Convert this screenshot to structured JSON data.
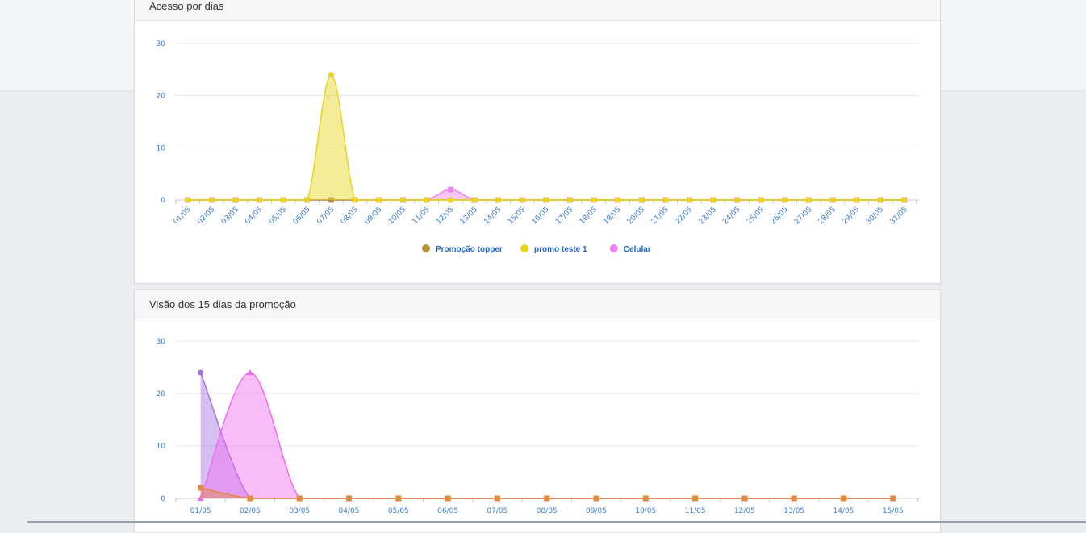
{
  "panels": [
    {
      "title": "Acesso por dias"
    },
    {
      "title": "Visão dos 15 dias da promoção"
    }
  ],
  "chart_data": [
    {
      "type": "area",
      "title": "Acesso por dias",
      "xlabel": "",
      "ylabel": "",
      "ylim": [
        0,
        30
      ],
      "yticks": [
        0,
        10,
        20,
        30
      ],
      "grid": true,
      "legend": "bottom-center",
      "categories": [
        "01/05",
        "02/05",
        "03/05",
        "04/05",
        "05/05",
        "06/05",
        "07/05",
        "08/05",
        "09/05",
        "10/05",
        "11/05",
        "12/05",
        "13/05",
        "14/05",
        "15/05",
        "16/05",
        "17/05",
        "18/05",
        "19/05",
        "20/05",
        "21/05",
        "22/05",
        "23/05",
        "24/05",
        "25/05",
        "26/05",
        "27/05",
        "28/05",
        "29/05",
        "30/05",
        "31/05"
      ],
      "series": [
        {
          "name": "Promoção topper",
          "color": "#b0923a",
          "marker": "circle",
          "values": [
            0,
            0,
            0,
            0,
            0,
            0,
            0,
            0,
            0,
            0,
            0,
            0,
            0,
            0,
            0,
            0,
            0,
            0,
            0,
            0,
            0,
            0,
            0,
            0,
            0,
            0,
            0,
            0,
            0,
            0,
            0
          ]
        },
        {
          "name": "promo teste 1",
          "color": "#e8d51e",
          "marker": "circle",
          "values": [
            0,
            0,
            0,
            0,
            0,
            0,
            24,
            0,
            0,
            0,
            0,
            0,
            0,
            0,
            0,
            0,
            0,
            0,
            0,
            0,
            0,
            0,
            0,
            0,
            0,
            0,
            0,
            0,
            0,
            0,
            0
          ]
        },
        {
          "name": "Celular",
          "color": "#ee82ee",
          "marker": "square",
          "values": [
            0,
            0,
            0,
            0,
            0,
            0,
            0,
            0,
            0,
            0,
            0,
            2,
            0,
            0,
            0,
            0,
            0,
            0,
            0,
            0,
            0,
            0,
            0,
            0,
            0,
            0,
            0,
            0,
            0,
            0,
            0
          ]
        }
      ]
    },
    {
      "type": "area",
      "title": "Visão dos 15 dias da promoção",
      "xlabel": "",
      "ylabel": "",
      "ylim": [
        0,
        30
      ],
      "yticks": [
        0,
        10,
        20,
        30
      ],
      "grid": true,
      "categories": [
        "01/05",
        "02/05",
        "03/05",
        "04/05",
        "05/05",
        "06/05",
        "07/05",
        "08/05",
        "09/05",
        "10/05",
        "11/05",
        "12/05",
        "13/05",
        "14/05",
        "15/05"
      ],
      "series": [
        {
          "color": "#a472e0",
          "marker": "circle",
          "values": [
            24,
            0,
            0,
            0,
            0,
            0,
            0,
            0,
            0,
            0,
            0,
            0,
            0,
            0,
            0
          ]
        },
        {
          "color": "#f06cf0",
          "marker": "triangle",
          "values": [
            0,
            24,
            0,
            0,
            0,
            0,
            0,
            0,
            0,
            0,
            0,
            0,
            0,
            0,
            0
          ]
        },
        {
          "color": "#e08a3c",
          "marker": "square",
          "values": [
            2,
            0,
            0,
            0,
            0,
            0,
            0,
            0,
            0,
            0,
            0,
            0,
            0,
            0,
            0
          ]
        }
      ]
    }
  ]
}
